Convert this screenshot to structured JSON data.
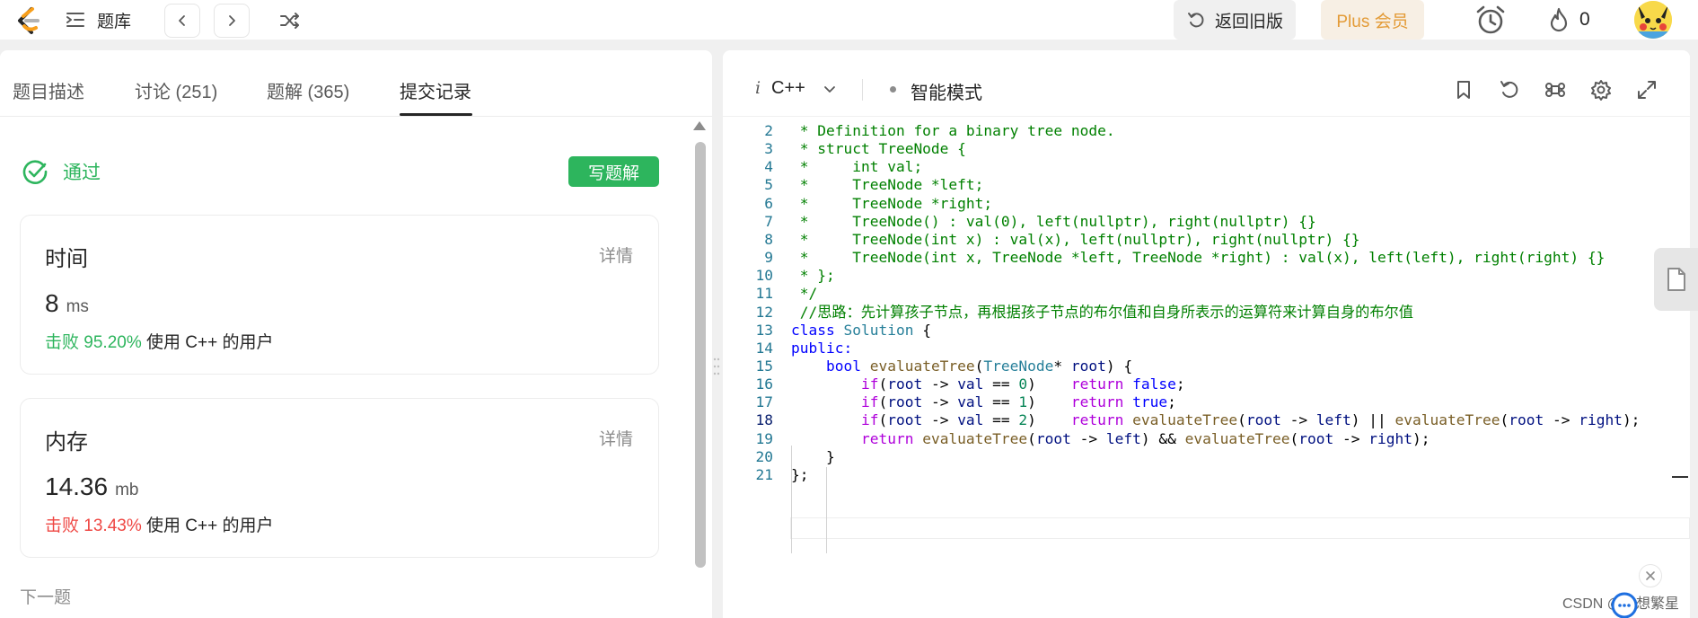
{
  "topbar": {
    "problem_bank": "题库",
    "old_version": "返回旧版",
    "plus": "Plus 会员",
    "streak_count": "0"
  },
  "left": {
    "tabs": [
      {
        "label": "题目描述"
      },
      {
        "label": "讨论 (251)"
      },
      {
        "label": "题解 (365)"
      },
      {
        "label": "提交记录"
      }
    ],
    "status": "通过",
    "write_solution": "写题解",
    "runtime": {
      "title": "时间",
      "detail": "详情",
      "value": "8",
      "unit": "ms",
      "beat_label": "击败 95.20%",
      "beat_suffix": "使用 C++ 的用户"
    },
    "memory": {
      "title": "内存",
      "detail": "详情",
      "value": "14.36",
      "unit": "mb",
      "beat_label": "击败 13.43%",
      "beat_suffix": "使用 C++ 的用户"
    },
    "next_question": "下一题"
  },
  "editor": {
    "lang_icon": "i",
    "language": "C++",
    "mode": "智能模式",
    "current_line": 18,
    "lines": [
      {
        "n": "2",
        "tokens": [
          {
            "t": " * Definition for a binary tree node.",
            "c": "com"
          }
        ]
      },
      {
        "n": "3",
        "tokens": [
          {
            "t": " * struct TreeNode {",
            "c": "com"
          }
        ]
      },
      {
        "n": "4",
        "tokens": [
          {
            "t": " *     int val;",
            "c": "com"
          }
        ]
      },
      {
        "n": "5",
        "tokens": [
          {
            "t": " *     TreeNode *left;",
            "c": "com"
          }
        ]
      },
      {
        "n": "6",
        "tokens": [
          {
            "t": " *     TreeNode *right;",
            "c": "com"
          }
        ]
      },
      {
        "n": "7",
        "tokens": [
          {
            "t": " *     TreeNode() : val(0), left(nullptr), right(nullptr) {}",
            "c": "com"
          }
        ]
      },
      {
        "n": "8",
        "tokens": [
          {
            "t": " *     TreeNode(int x) : val(x), left(nullptr), right(nullptr) {}",
            "c": "com"
          }
        ]
      },
      {
        "n": "9",
        "tokens": [
          {
            "t": " *     TreeNode(int x, TreeNode *left, TreeNode *right) : val(x), left(left), right(right) {}",
            "c": "com"
          }
        ]
      },
      {
        "n": "10",
        "tokens": [
          {
            "t": " * };",
            "c": "com"
          }
        ]
      },
      {
        "n": "11",
        "tokens": [
          {
            "t": " */",
            "c": "com"
          }
        ]
      },
      {
        "n": "12",
        "tokens": [
          {
            "t": " //思路：先计算孩子节点，再根据孩子节点的布尔值和自身所表示的运算符来计算自身的布尔值",
            "c": "com"
          }
        ]
      },
      {
        "n": "13",
        "tokens": [
          {
            "t": "class ",
            "c": "kw"
          },
          {
            "t": "Solution",
            "c": "type"
          },
          {
            "t": " {",
            "c": "plain"
          }
        ]
      },
      {
        "n": "14",
        "tokens": [
          {
            "t": "public:",
            "c": "kw"
          }
        ]
      },
      {
        "n": "15",
        "tokens": [
          {
            "t": "    ",
            "c": "plain"
          },
          {
            "t": "bool ",
            "c": "kw"
          },
          {
            "t": "evaluateTree",
            "c": "fn"
          },
          {
            "t": "(",
            "c": "plain"
          },
          {
            "t": "TreeNode",
            "c": "type"
          },
          {
            "t": "* ",
            "c": "plain"
          },
          {
            "t": "root",
            "c": "var"
          },
          {
            "t": ") {",
            "c": "plain"
          }
        ]
      },
      {
        "n": "16",
        "tokens": [
          {
            "t": "        ",
            "c": "plain"
          },
          {
            "t": "if",
            "c": "ctl"
          },
          {
            "t": "(",
            "c": "plain"
          },
          {
            "t": "root",
            "c": "var"
          },
          {
            "t": " -> ",
            "c": "plain"
          },
          {
            "t": "val",
            "c": "var"
          },
          {
            "t": " == ",
            "c": "plain"
          },
          {
            "t": "0",
            "c": "num"
          },
          {
            "t": ")    ",
            "c": "plain"
          },
          {
            "t": "return ",
            "c": "ctl"
          },
          {
            "t": "false",
            "c": "kw"
          },
          {
            "t": ";",
            "c": "plain"
          }
        ]
      },
      {
        "n": "17",
        "tokens": [
          {
            "t": "        ",
            "c": "plain"
          },
          {
            "t": "if",
            "c": "ctl"
          },
          {
            "t": "(",
            "c": "plain"
          },
          {
            "t": "root",
            "c": "var"
          },
          {
            "t": " -> ",
            "c": "plain"
          },
          {
            "t": "val",
            "c": "var"
          },
          {
            "t": " == ",
            "c": "plain"
          },
          {
            "t": "1",
            "c": "num"
          },
          {
            "t": ")    ",
            "c": "plain"
          },
          {
            "t": "return ",
            "c": "ctl"
          },
          {
            "t": "true",
            "c": "kw"
          },
          {
            "t": ";",
            "c": "plain"
          }
        ]
      },
      {
        "n": "18",
        "tokens": [
          {
            "t": "        ",
            "c": "plain"
          },
          {
            "t": "if",
            "c": "ctl"
          },
          {
            "t": "(",
            "c": "plain"
          },
          {
            "t": "root",
            "c": "var"
          },
          {
            "t": " -> ",
            "c": "plain"
          },
          {
            "t": "val",
            "c": "var"
          },
          {
            "t": " == ",
            "c": "plain"
          },
          {
            "t": "2",
            "c": "num"
          },
          {
            "t": ")    ",
            "c": "plain"
          },
          {
            "t": "return ",
            "c": "ctl"
          },
          {
            "t": "evaluateTree",
            "c": "fn"
          },
          {
            "t": "(",
            "c": "plain"
          },
          {
            "t": "root",
            "c": "var"
          },
          {
            "t": " -> ",
            "c": "plain"
          },
          {
            "t": "left",
            "c": "var"
          },
          {
            "t": ") || ",
            "c": "plain"
          },
          {
            "t": "evaluateTree",
            "c": "fn"
          },
          {
            "t": "(",
            "c": "plain"
          },
          {
            "t": "root",
            "c": "var"
          },
          {
            "t": " -> ",
            "c": "plain"
          },
          {
            "t": "right",
            "c": "var"
          },
          {
            "t": ");",
            "c": "plain"
          }
        ]
      },
      {
        "n": "19",
        "tokens": [
          {
            "t": "        ",
            "c": "plain"
          },
          {
            "t": "return ",
            "c": "ctl"
          },
          {
            "t": "evaluateTree",
            "c": "fn"
          },
          {
            "t": "(",
            "c": "plain"
          },
          {
            "t": "root",
            "c": "var"
          },
          {
            "t": " -> ",
            "c": "plain"
          },
          {
            "t": "left",
            "c": "var"
          },
          {
            "t": ") && ",
            "c": "plain"
          },
          {
            "t": "evaluateTree",
            "c": "fn"
          },
          {
            "t": "(",
            "c": "plain"
          },
          {
            "t": "root",
            "c": "var"
          },
          {
            "t": " -> ",
            "c": "plain"
          },
          {
            "t": "right",
            "c": "var"
          },
          {
            "t": ");",
            "c": "plain"
          }
        ]
      },
      {
        "n": "20",
        "tokens": [
          {
            "t": "    }",
            "c": "plain"
          }
        ]
      },
      {
        "n": "21",
        "tokens": [
          {
            "t": "};",
            "c": "plain"
          }
        ]
      }
    ]
  },
  "watermark": "CSDN @思想繁星",
  "colors": {
    "accent_green": "#2db55d",
    "beat_red": "#ef4743",
    "plus_orange": "#e39b37"
  }
}
